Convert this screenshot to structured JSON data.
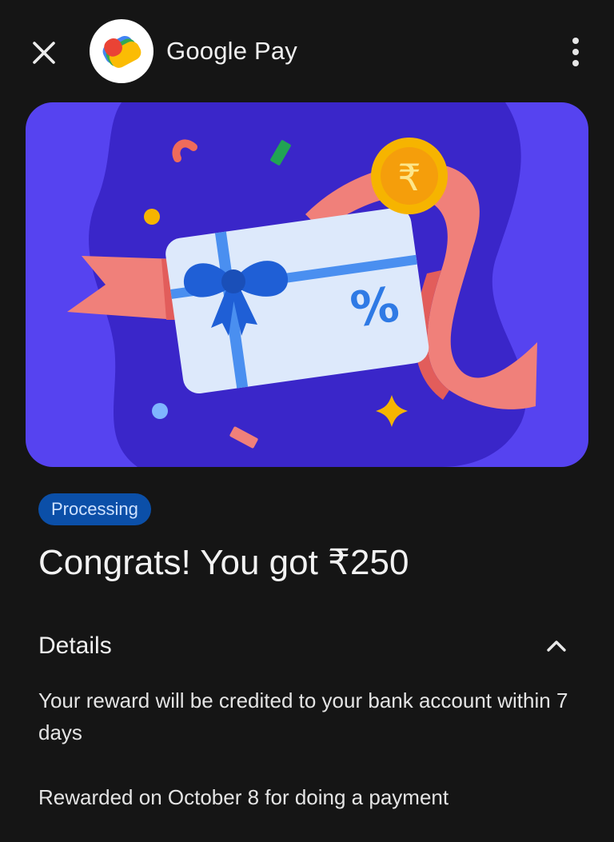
{
  "header": {
    "app_title": "Google Pay",
    "close_icon": "close-icon",
    "menu_icon": "more-vert-icon"
  },
  "banner": {
    "art": "gift-card-illustration",
    "card_symbol": "%",
    "coin_symbol": "₹",
    "colors": {
      "background": "#5643f0",
      "blob": "#3a26c9",
      "card": "#dde9fb",
      "ribbon": "#f0807a",
      "bow": "#1f5fd6",
      "coin": "#f6b400"
    }
  },
  "status": {
    "label": "Processing"
  },
  "reward": {
    "headline": "Congrats! You got ₹250"
  },
  "details": {
    "title": "Details",
    "expanded": true,
    "description": "Your reward will be credited to your bank account within 7 days",
    "rewarded_on": "Rewarded on October 8 for doing a payment"
  }
}
